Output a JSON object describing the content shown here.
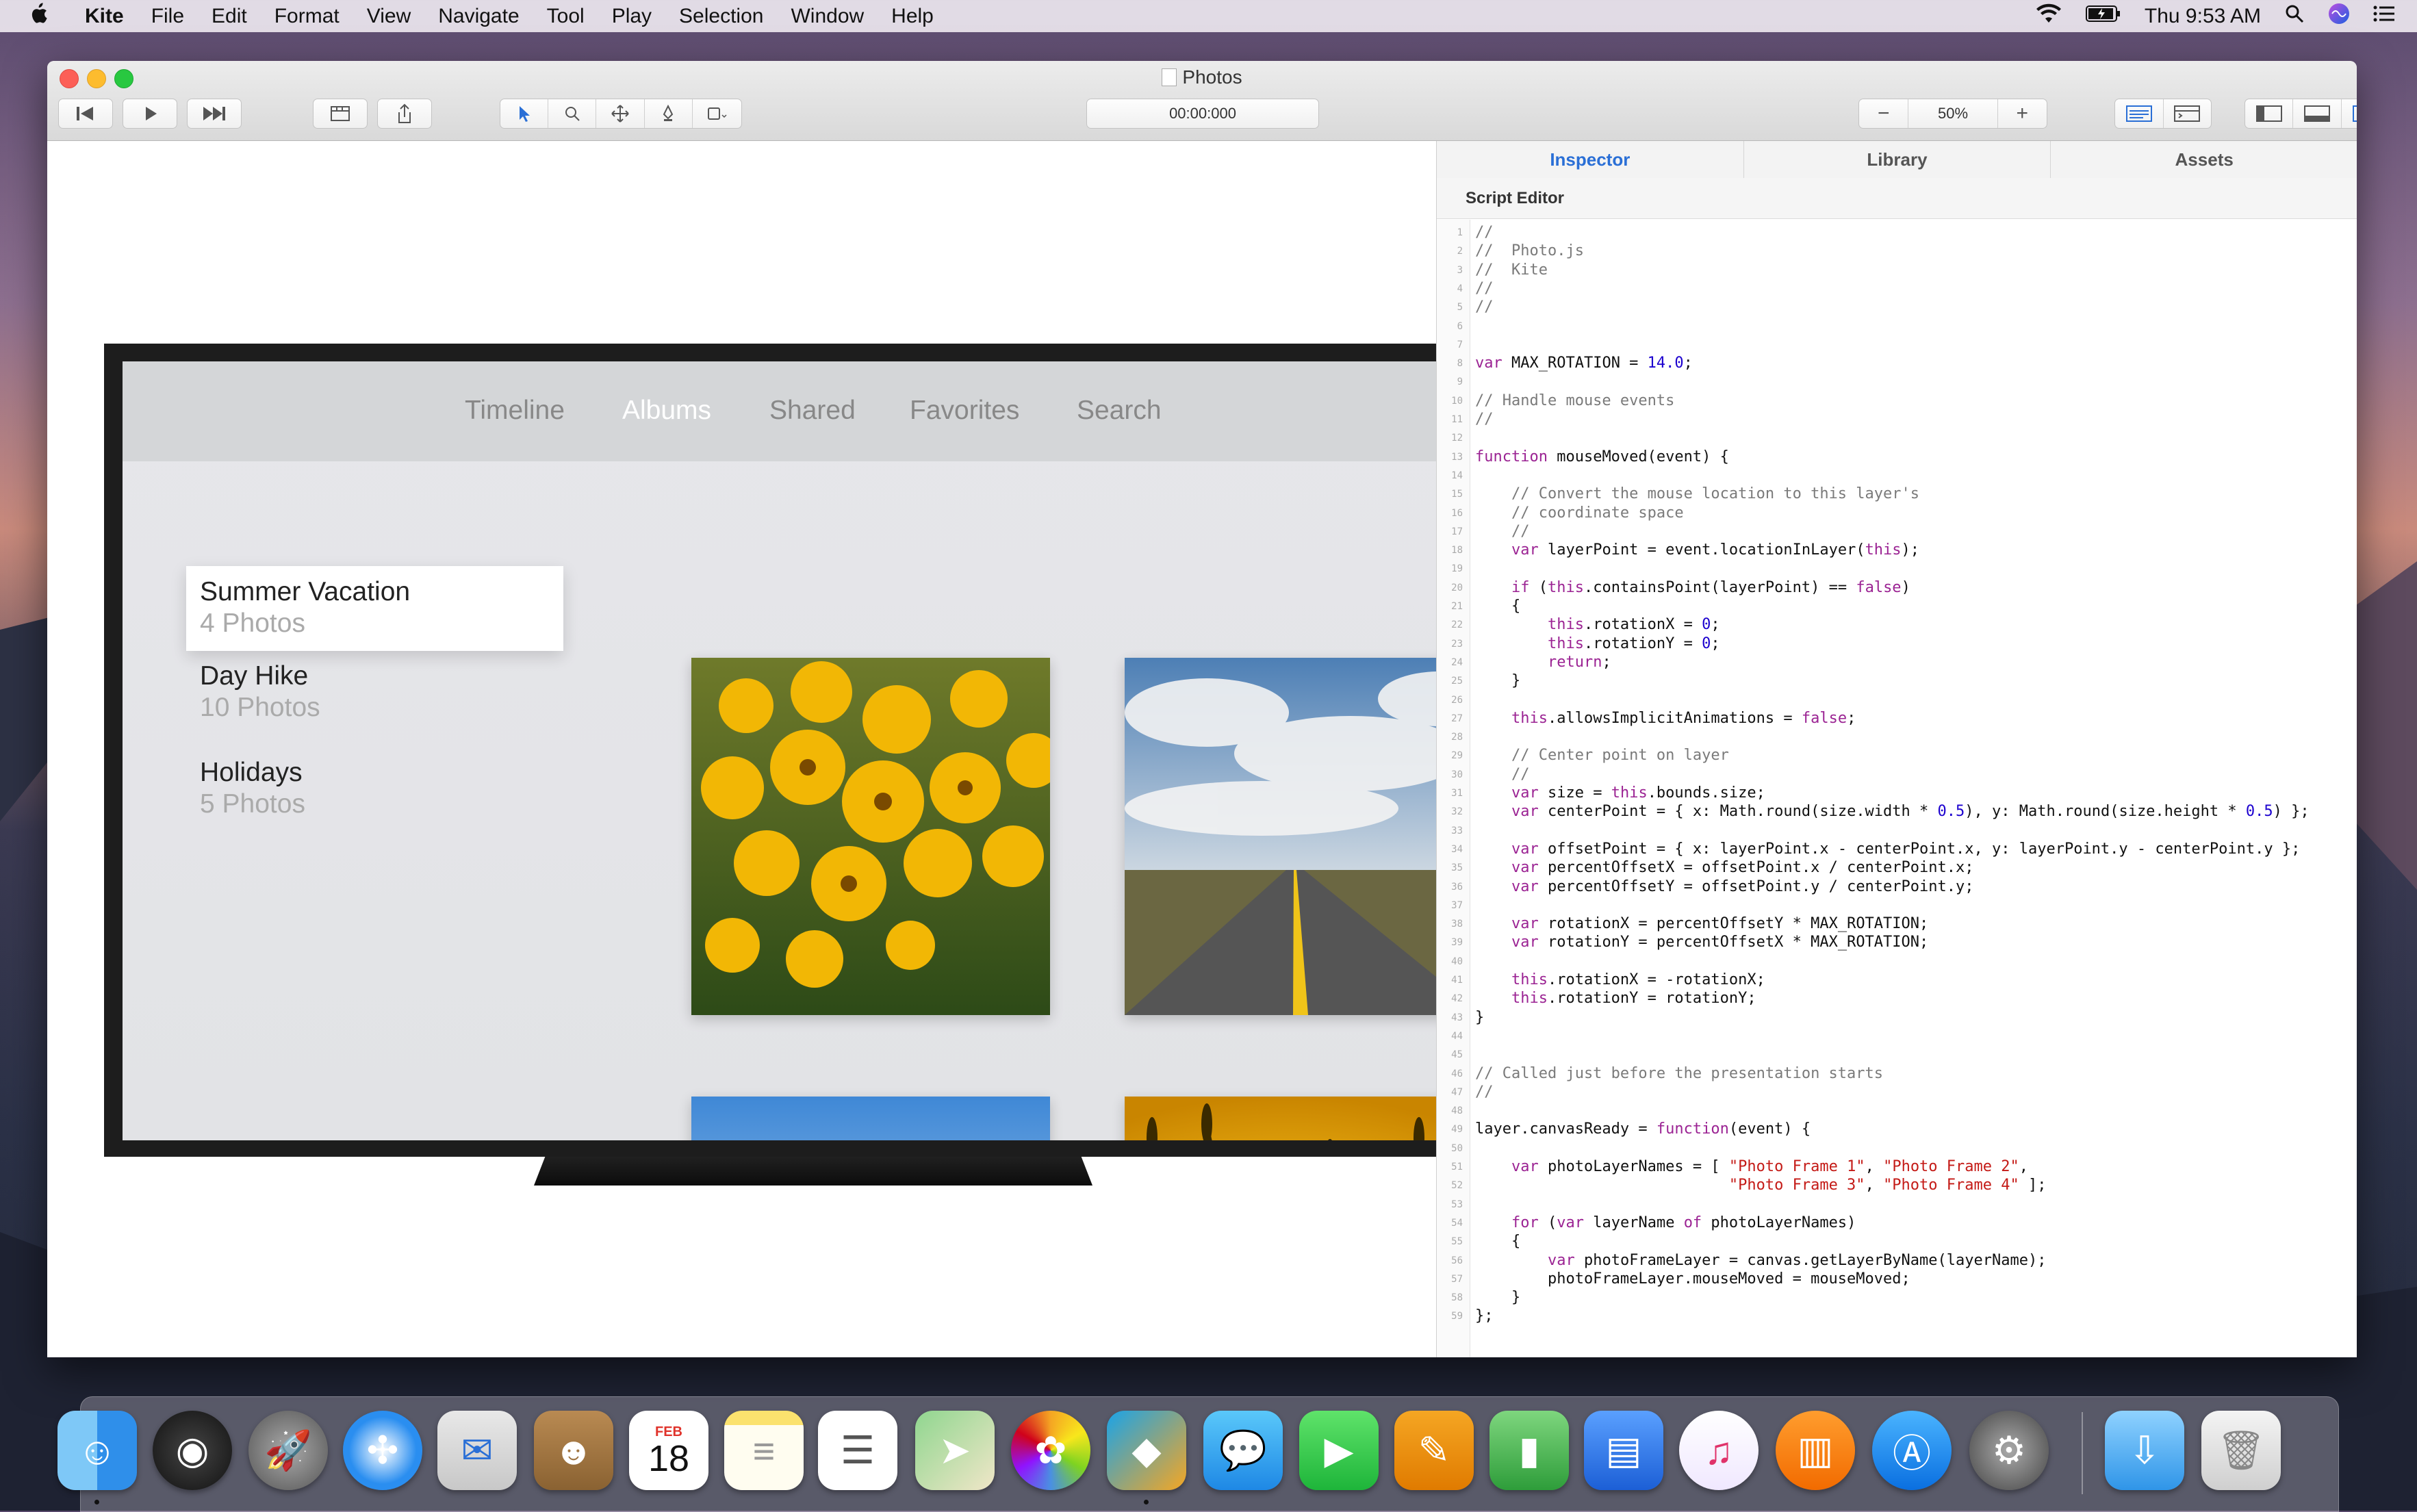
{
  "menubar": {
    "apple_icon": "apple-icon",
    "app_name": "Kite",
    "items": [
      "File",
      "Edit",
      "Format",
      "View",
      "Navigate",
      "Tool",
      "Play",
      "Selection",
      "Window",
      "Help"
    ],
    "clock": "Thu 9:53 AM",
    "status_icons": [
      "wifi-icon",
      "battery-icon",
      "spotlight-icon",
      "siri-icon",
      "notification-center-icon"
    ]
  },
  "window": {
    "title": "Photos",
    "timecode": "00:00:000",
    "zoom": "50%",
    "zoom_minus": "−",
    "zoom_plus": "+"
  },
  "tv": {
    "tabs": [
      "Timeline",
      "Albums",
      "Shared",
      "Favorites",
      "Search"
    ],
    "active_tab": "Albums",
    "albums": [
      {
        "name": "Summer Vacation",
        "count": "4 Photos"
      },
      {
        "name": "Day Hike",
        "count": "10 Photos"
      },
      {
        "name": "Holidays",
        "count": "5 Photos"
      }
    ]
  },
  "inspector": {
    "tabs": [
      "Inspector",
      "Library",
      "Assets"
    ],
    "active_tab": "Inspector",
    "section_title": "Script Editor",
    "code_lines": [
      "//",
      "//  Photo.js",
      "//  Kite",
      "//",
      "//",
      "",
      "",
      "var MAX_ROTATION = 14.0;",
      "",
      "// Handle mouse events",
      "//",
      "",
      "function mouseMoved(event) {",
      "",
      "    // Convert the mouse location to this layer's",
      "    // coordinate space",
      "    //",
      "    var layerPoint = event.locationInLayer(this);",
      "",
      "    if (this.containsPoint(layerPoint) == false)",
      "    {",
      "        this.rotationX = 0;",
      "        this.rotationY = 0;",
      "        return;",
      "    }",
      "",
      "    this.allowsImplicitAnimations = false;",
      "",
      "    // Center point on layer",
      "    //",
      "    var size = this.bounds.size;",
      "    var centerPoint = { x: Math.round(size.width * 0.5), y: Math.round(size.height * 0.5) };",
      "",
      "    var offsetPoint = { x: layerPoint.x - centerPoint.x, y: layerPoint.y - centerPoint.y };",
      "    var percentOffsetX = offsetPoint.x / centerPoint.x;",
      "    var percentOffsetY = offsetPoint.y / centerPoint.y;",
      "",
      "    var rotationX = percentOffsetY * MAX_ROTATION;",
      "    var rotationY = percentOffsetX * MAX_ROTATION;",
      "",
      "    this.rotationX = -rotationX;",
      "    this.rotationY = rotationY;",
      "}",
      "",
      "",
      "// Called just before the presentation starts",
      "//",
      "",
      "layer.canvasReady = function(event) {",
      "",
      "    var photoLayerNames = [ \"Photo Frame 1\", \"Photo Frame 2\",",
      "                            \"Photo Frame 3\", \"Photo Frame 4\" ];",
      "",
      "    for (var layerName of photoLayerNames)",
      "    {",
      "        var photoFrameLayer = canvas.getLayerByName(layerName);",
      "        photoFrameLayer.mouseMoved = mouseMoved;",
      "    }",
      "};"
    ]
  },
  "dock": {
    "apps": [
      "finder-icon",
      "siri-icon",
      "launchpad-icon",
      "safari-icon",
      "mail-icon",
      "contacts-icon",
      "calendar-icon",
      "notes-icon",
      "reminders-icon",
      "maps-icon",
      "photos-icon",
      "kite-icon",
      "messages-icon",
      "facetime-icon",
      "pages-icon",
      "numbers-icon",
      "keynote-icon",
      "itunes-icon",
      "ibooks-icon",
      "app-store-icon",
      "system-preferences-icon",
      "downloads-icon",
      "trash-icon"
    ],
    "calendar_month": "FEB",
    "calendar_day": "18"
  },
  "colors": {
    "accent": "#2a6fd6",
    "keyword": "#9b2393",
    "comment": "#7a7a7a",
    "number": "#1c00cf",
    "string": "#c41a16"
  }
}
